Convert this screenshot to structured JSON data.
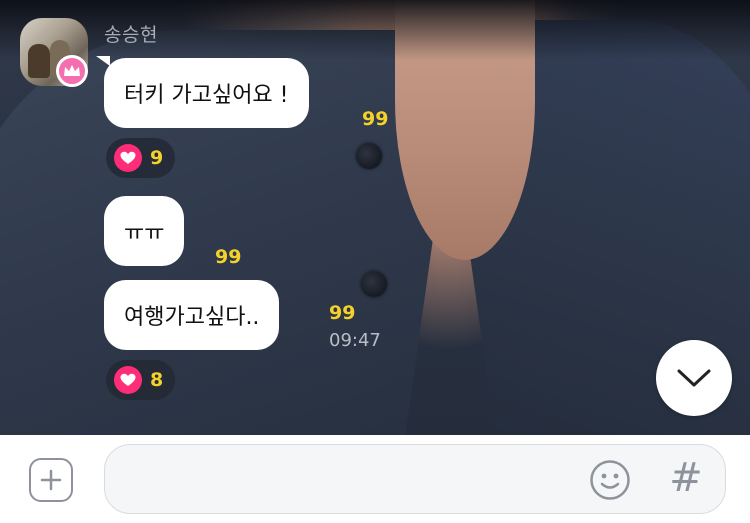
{
  "sender": {
    "name": "송승현"
  },
  "messages": [
    {
      "text": "터키 가고싶어요 !",
      "read_count": "99"
    },
    {
      "text": "ㅠㅠ",
      "read_count": "99"
    },
    {
      "text": "여행가고싶다..",
      "read_count": "99",
      "time": "09:47"
    }
  ],
  "reactions": [
    {
      "icon": "heart-icon",
      "count": "9"
    },
    {
      "icon": "heart-icon",
      "count": "8"
    }
  ],
  "composer": {
    "placeholder": "",
    "add_icon": "plus-square-icon",
    "emoji_icon": "smiley-icon",
    "hashtag_label": "#"
  },
  "colors": {
    "bubble": "#ffffff",
    "read_count": "#f5d22a",
    "heart": "#ff2c78",
    "crown_badge": "#f36fb0",
    "icon_gray": "#8e939b"
  }
}
